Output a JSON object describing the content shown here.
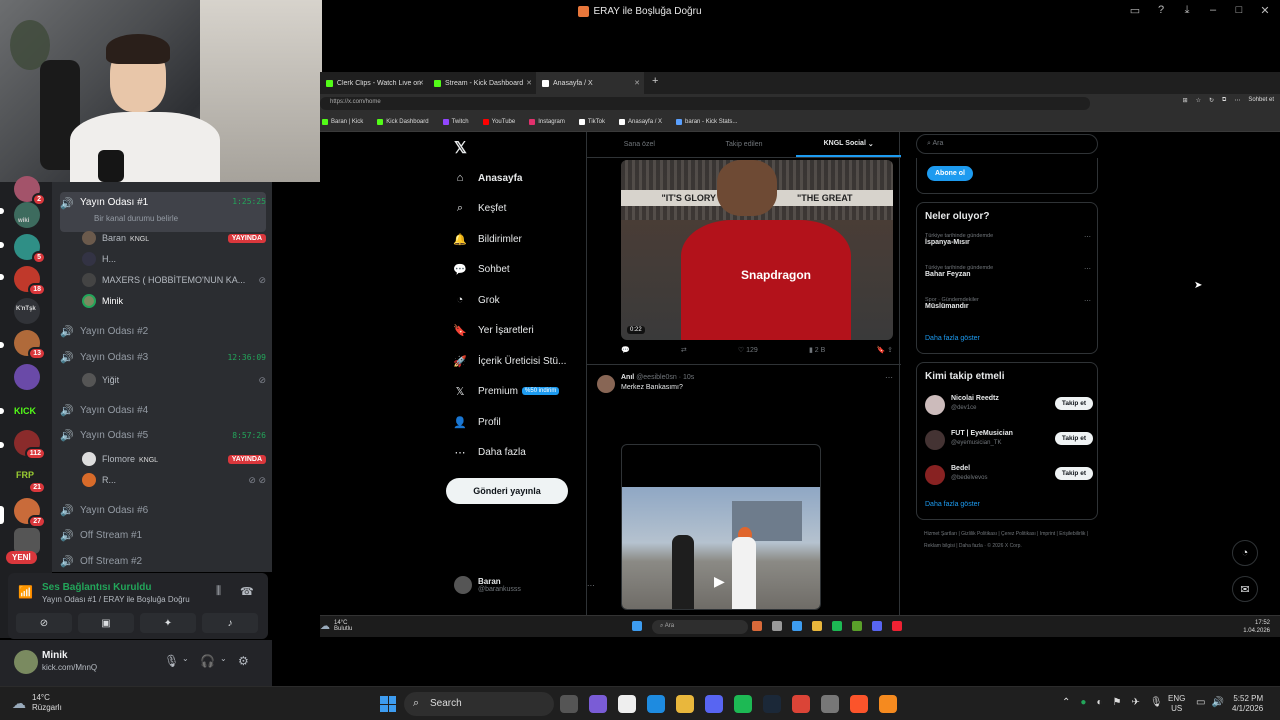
{
  "window": {
    "title": "ERAY ile Boşluğa Doğru"
  },
  "discord": {
    "servers": [
      {
        "badge": "2",
        "color": "#a3536a"
      },
      {
        "label": "wiki",
        "badge": "",
        "color": "#3d6b5e"
      },
      {
        "badge": "5",
        "color": "#2f8f86"
      },
      {
        "badge": "18",
        "color": "#c0392b"
      },
      {
        "label": "K'nTşk",
        "badge": "",
        "color": "#313338"
      },
      {
        "badge": "13",
        "color": "#b06a3a"
      },
      {
        "badge": "",
        "color": "#6a4aa8"
      },
      {
        "label": "KICK",
        "badge": "",
        "color": "#1e1f22"
      },
      {
        "badge": "112",
        "color": "#8a2b2b"
      },
      {
        "label": "FRP",
        "badge": "21",
        "color": "#1e1f22"
      },
      {
        "badge": "27",
        "color": "#c96b3a"
      },
      {
        "badge": "",
        "color": "#555"
      }
    ],
    "new_badge": "YENİ",
    "channels": {
      "active": {
        "name": "Yayın Odası #1",
        "timer": "1:25:25",
        "subtitle": "Bir kanal durumu belirle"
      },
      "users_room1": [
        {
          "name": "Baran",
          "tag": "KNGL",
          "live": "YAYINDA"
        },
        {
          "name": "H...",
          "tag": "",
          "live": ""
        },
        {
          "name": "MAXERS ( HOBBİTEMO'NUN KA...",
          "tag": "",
          "live": ""
        },
        {
          "name": "Minik",
          "tag": "",
          "live": ""
        }
      ],
      "room2": "Yayın Odası #2",
      "room3": {
        "name": "Yayın Odası #3",
        "timer": "12:36:09"
      },
      "room3_user": "Yiğit",
      "room4": "Yayın Odası #4",
      "room5": {
        "name": "Yayın Odası #5",
        "timer": "8:57:26"
      },
      "room5_users": [
        {
          "name": "Flomore",
          "tag": "KNGL",
          "live": "YAYINDA"
        },
        {
          "name": "R...",
          "tag": "",
          "live": ""
        }
      ],
      "room6": "Yayın Odası #6",
      "off1": "Off Stream #1",
      "off2": "Off Stream #2"
    },
    "voice": {
      "status": "Ses Bağlantısı Kuruldu",
      "location": "Yayın Odası #1 / ERAY ile Boşluğa Doğru"
    },
    "user": {
      "name": "Minik",
      "status": "kick.com/MnnQ"
    }
  },
  "browser": {
    "tabs": [
      {
        "label": "Clerk Clips - Watch Live on Kick",
        "color": "#53fc18"
      },
      {
        "label": "Stream - Kick Dashboard",
        "color": "#53fc18"
      },
      {
        "label": "Anasayfa / X",
        "color": "#ffffff"
      }
    ],
    "url": "https://x.com/home",
    "profile_label": "Sohbet et",
    "bookmarks": [
      {
        "label": "Baran | Kick",
        "color": "#53fc18"
      },
      {
        "label": "Kick Dashboard",
        "color": "#53fc18"
      },
      {
        "label": "Twitch",
        "color": "#9146ff"
      },
      {
        "label": "YouTube",
        "color": "#ff0000"
      },
      {
        "label": "Instagram",
        "color": "#e1306c"
      },
      {
        "label": "TikTok",
        "color": "#ffffff"
      },
      {
        "label": "Anasayfa / X",
        "color": "#ffffff"
      },
      {
        "label": "baran - Kick Stats...",
        "color": "#5aa0ff"
      }
    ]
  },
  "x": {
    "nav": {
      "home": "Anasayfa",
      "explore": "Keşfet",
      "notifications": "Bildirimler",
      "chat": "Sohbet",
      "grok": "Grok",
      "bookmarks": "Yer İşaretleri",
      "creator": "İçerik Üreticisi Stü...",
      "premium": "Premium",
      "premium_badge": "%50 indirim",
      "profile": "Profil",
      "more": "Daha fazla"
    },
    "post_button": "Gönderi yayınla",
    "account": {
      "name": "Baran",
      "handle": "@barankusss"
    },
    "feed_tabs": [
      "Sana özel",
      "Takip edilen",
      "KNGL Social"
    ],
    "tweet1": {
      "banner_left": "\"IT'S GLORY",
      "banner_right": "\"THE GREAT",
      "sponsor": "Snapdragon",
      "duration": "0:22",
      "likes": "129",
      "views": "2 B"
    },
    "tweet2": {
      "name": "Anıl",
      "handle": "@eesible0sn · 10s",
      "text": "Merkez Bankasımı?"
    },
    "search_placeholder": "Ara",
    "subscribe": "Abone ol",
    "trends_title": "Neler oluyor?",
    "trends": [
      {
        "context": "Türkiye tarihinde gündemde",
        "topic": "İspanya-Mısır"
      },
      {
        "context": "Türkiye tarihinde gündemde",
        "topic": "Bahar Feyzan"
      },
      {
        "context": "Spor · Gündemdekiler",
        "topic": "Müslümandır"
      }
    ],
    "show_more": "Daha fazla göster",
    "follow_title": "Kimi takip etmeli",
    "follow": [
      {
        "name": "Nicolai Reedtz",
        "handle": "@dev1ce",
        "button": "Takip et"
      },
      {
        "name": "FUT | EyeMusician",
        "handle": "@eyemusician_TK",
        "button": "Takip et"
      },
      {
        "name": "Bedel",
        "handle": "@bedelvevos",
        "button": "Takip et"
      }
    ],
    "footer": "Hizmet Şartları  |  Gizlilik Politikası  |  Çerez Politikası  |  Imprint  |  Erişilebilirlik  |  Reklam bilgisi  |  Daha fazla  ·  © 2026 X Corp."
  },
  "inner_taskbar": {
    "temp": "14°C",
    "weather": "Bulutlu",
    "search": "Ara",
    "time": "17:52",
    "date": "1.04.2026"
  },
  "taskbar": {
    "temp": "14°C",
    "weather": "Rüzgarlı",
    "search": "Search",
    "lang1": "ENG",
    "lang2": "US",
    "time": "5:52 PM",
    "date": "4/1/2026"
  }
}
